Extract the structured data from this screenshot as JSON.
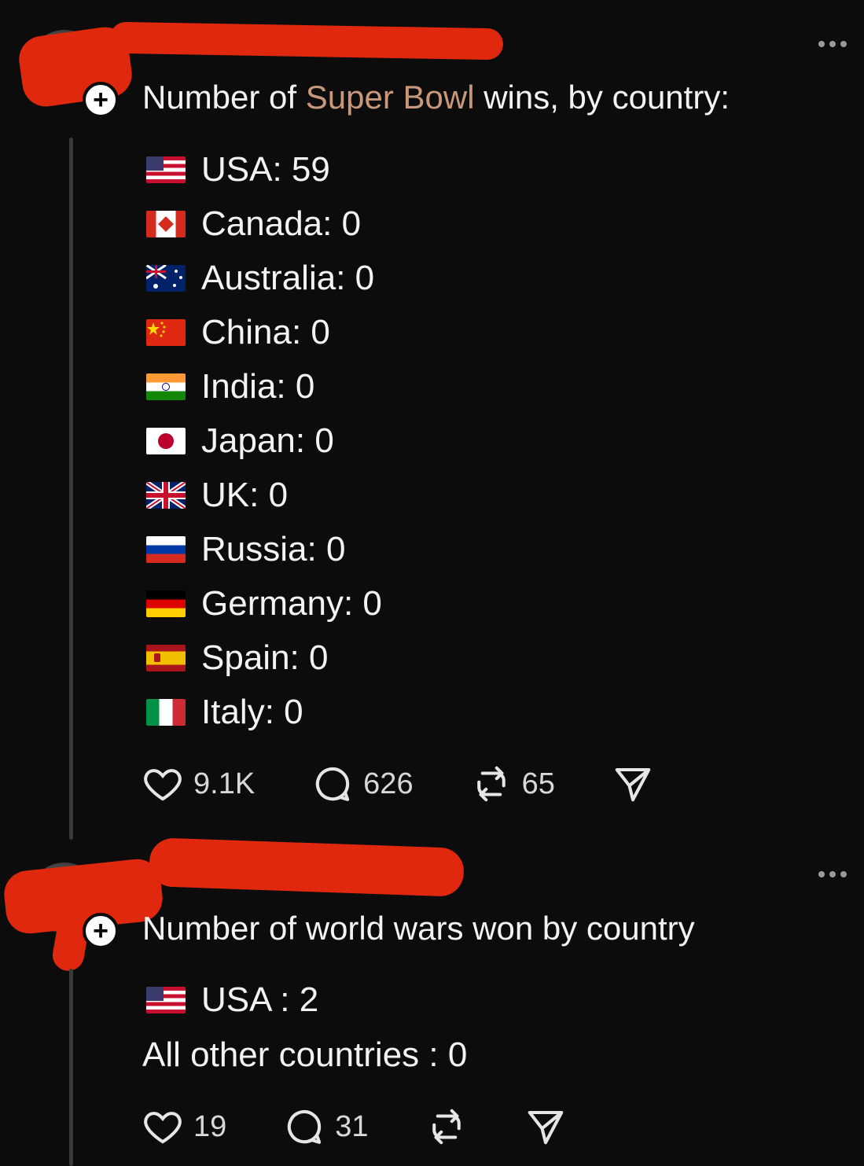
{
  "post1": {
    "title_prefix": "Number of ",
    "title_highlight": "Super Bowl",
    "title_suffix": " wins, by country:",
    "follow_symbol": "+",
    "countries": [
      {
        "flag": "us-flag-icon",
        "label": "USA: 59"
      },
      {
        "flag": "canada-flag-icon",
        "label": "Canada: 0"
      },
      {
        "flag": "australia-flag-icon",
        "label": "Australia: 0"
      },
      {
        "flag": "china-flag-icon",
        "label": "China: 0"
      },
      {
        "flag": "india-flag-icon",
        "label": "India: 0"
      },
      {
        "flag": "japan-flag-icon",
        "label": "Japan: 0"
      },
      {
        "flag": "uk-flag-icon",
        "label": "UK: 0"
      },
      {
        "flag": "russia-flag-icon",
        "label": "Russia: 0"
      },
      {
        "flag": "germany-flag-icon",
        "label": "Germany: 0"
      },
      {
        "flag": "spain-flag-icon",
        "label": "Spain: 0"
      },
      {
        "flag": "italy-flag-icon",
        "label": "Italy: 0"
      }
    ],
    "likes": "9.1K",
    "replies": "626",
    "reposts": "65"
  },
  "post2": {
    "title": "Number of world wars won by country",
    "follow_symbol": "+",
    "line1_flag": "us-flag-icon",
    "line1": "USA : 2",
    "line2": "All other countries : 0",
    "likes": "19",
    "replies": "31"
  },
  "colors": {
    "background": "#0c0c0c",
    "highlight": "#c8987a",
    "redaction": "#e0280f"
  }
}
